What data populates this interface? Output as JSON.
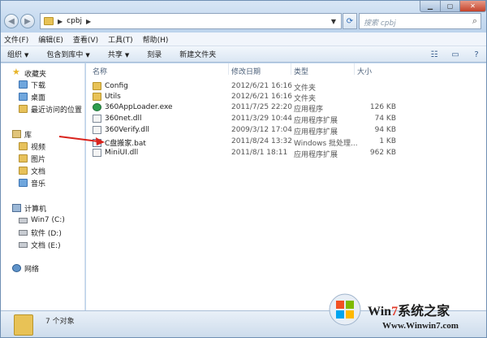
{
  "address": {
    "crumb": "cpbj",
    "search_placeholder": "搜索 cpbj"
  },
  "menu": [
    "文件(F)",
    "编辑(E)",
    "查看(V)",
    "工具(T)",
    "帮助(H)"
  ],
  "toolbar": {
    "organize": "组织",
    "include": "包含到库中",
    "share": "共享",
    "burn": "刻录",
    "new_folder": "新建文件夹"
  },
  "sidebar": {
    "favorites": "收藏夹",
    "downloads": "下载",
    "desktop": "桌面",
    "recent": "最近访问的位置",
    "libraries": "库",
    "videos": "视频",
    "pictures": "图片",
    "documents": "文档",
    "music": "音乐",
    "computer": "计算机",
    "drive_c": "Win7 (C:)",
    "drive_d": "软件 (D:)",
    "drive_e": "文档 (E:)",
    "network": "网络"
  },
  "columns": {
    "name": "名称",
    "date": "修改日期",
    "type": "类型",
    "size": "大小"
  },
  "files": [
    {
      "name": "Config",
      "date": "2012/6/21 16:16",
      "type": "文件夹",
      "size": "",
      "icon": "folder"
    },
    {
      "name": "Utils",
      "date": "2012/6/21 16:16",
      "type": "文件夹",
      "size": "",
      "icon": "folder"
    },
    {
      "name": "360AppLoader.exe",
      "date": "2011/7/25 22:20",
      "type": "应用程序",
      "size": "126 KB",
      "icon": "exe"
    },
    {
      "name": "360net.dll",
      "date": "2011/3/29 10:44",
      "type": "应用程序扩展",
      "size": "74 KB",
      "icon": "dll"
    },
    {
      "name": "360Verify.dll",
      "date": "2009/3/12 17:04",
      "type": "应用程序扩展",
      "size": "94 KB",
      "icon": "dll"
    },
    {
      "name": "C盘搬家.bat",
      "date": "2011/8/24 13:32",
      "type": "Windows 批处理...",
      "size": "1 KB",
      "icon": "bat"
    },
    {
      "name": "MiniUI.dll",
      "date": "2011/8/1 18:11",
      "type": "应用程序扩展",
      "size": "962 KB",
      "icon": "dll"
    }
  ],
  "status": {
    "count": "7 个对象"
  },
  "watermark": {
    "brand_a": "Win",
    "brand_b": "7",
    "brand_c": "系统之家",
    "url": "Www.Winwin7.com"
  },
  "colors": {
    "arrow": "#d9231d",
    "window_chrome": "#bcd3ec"
  }
}
